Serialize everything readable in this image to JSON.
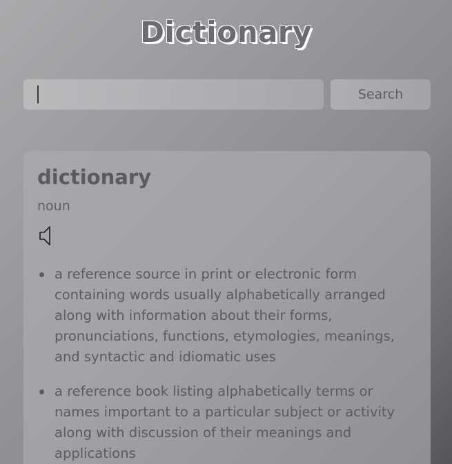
{
  "app": {
    "title": "Dictionary"
  },
  "search": {
    "value": "",
    "placeholder": "",
    "button_label": "Search"
  },
  "result": {
    "word": "dictionary",
    "part_of_speech": "noun",
    "audio_icon": "speaker-icon",
    "definitions": [
      "a reference source in print or electronic form containing words usually alphabetically arranged along with information about their forms, pronunciations, functions, etymologies, meanings, and syntactic and idiomatic uses",
      "a reference book listing alphabetically terms or names important to a particular subject or activity along with discussion of their meanings and applications"
    ]
  }
}
